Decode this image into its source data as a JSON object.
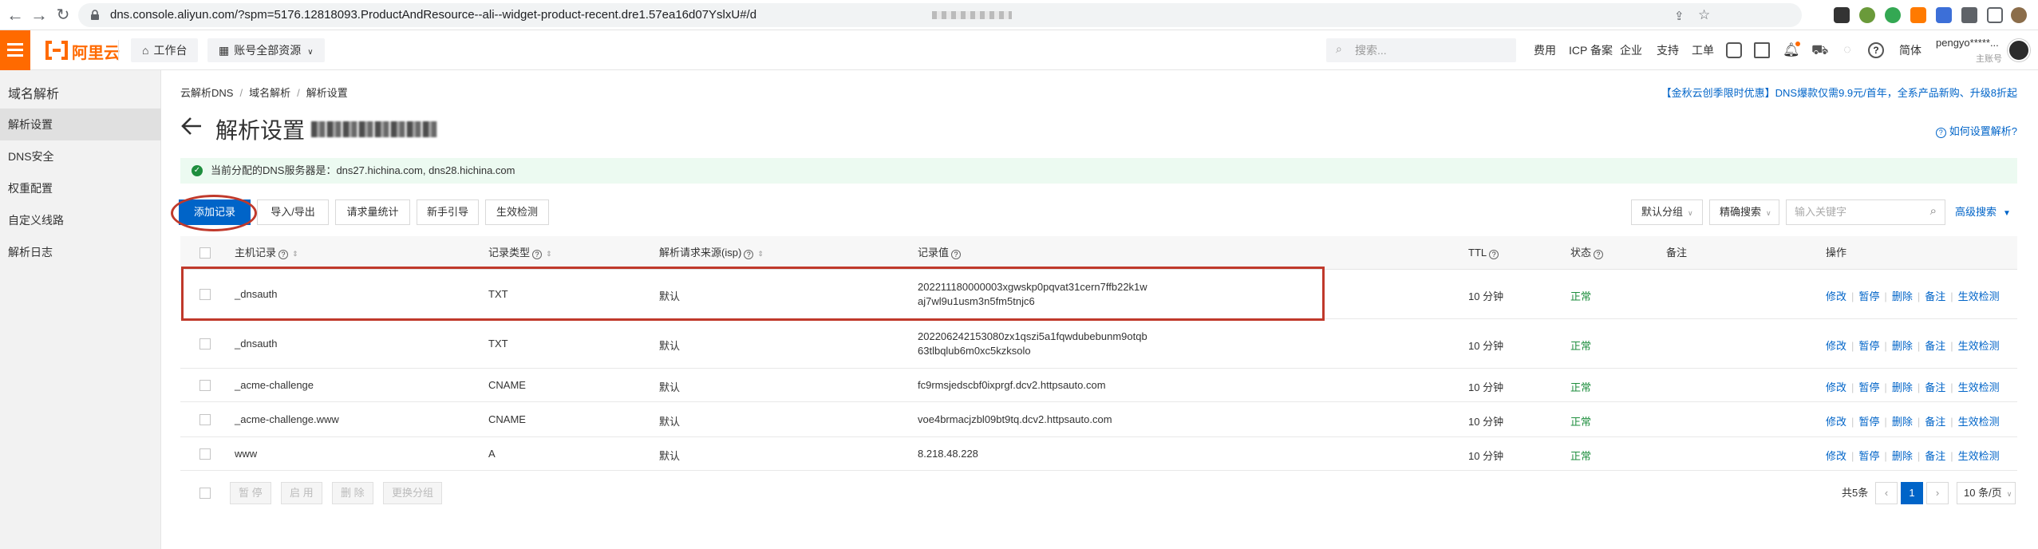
{
  "browser": {
    "url": "dns.console.aliyun.com/?spm=5176.12818093.ProductAndResource--ali--widget-product-recent.dre1.57ea16d07YslxU#/d"
  },
  "appbar": {
    "logo_text": "阿里云",
    "workbench": "工作台",
    "account_resources": "账号全部资源",
    "search_placeholder": "搜索...",
    "links": [
      "费用",
      "ICP 备案",
      "企业",
      "支持",
      "工单"
    ],
    "lang": "简体",
    "user_name": "pengyo*****...",
    "user_role": "主账号",
    "brand_color": "#ff6a00"
  },
  "sidebar": {
    "title": "域名解析",
    "items": [
      {
        "label": "解析设置",
        "active": true
      },
      {
        "label": "DNS安全",
        "active": false
      },
      {
        "label": "权重配置",
        "active": false
      },
      {
        "label": "自定义线路",
        "active": false
      },
      {
        "label": "解析日志",
        "active": false
      }
    ]
  },
  "main": {
    "breadcrumb": [
      "云解析DNS",
      "域名解析",
      "解析设置"
    ],
    "promo": "【金秋云创季限时优惠】DNS爆款仅需9.9元/首年，全系产品新购、升级8折起",
    "title": "解析设置",
    "help_link": "如何设置解析?",
    "notice": "当前分配的DNS服务器是：dns27.hichina.com, dns28.hichina.com",
    "toolbar": {
      "add_record": "添加记录",
      "import_export": "导入/导出",
      "request_stats": "请求量统计",
      "guide": "新手引导",
      "check": "生效检测",
      "group_select": "默认分组",
      "search_type": "精确搜索",
      "keyword_placeholder": "输入关键字",
      "advanced_search": "高级搜索"
    },
    "table": {
      "headers": {
        "host": "主机记录",
        "type": "记录类型",
        "isp": "解析请求来源(isp)",
        "value": "记录值",
        "ttl": "TTL",
        "status": "状态",
        "remark": "备注",
        "actions": "操作"
      },
      "rows": [
        {
          "host": "_dnsauth",
          "type": "TXT",
          "isp": "默认",
          "value1": "202211180000003xgwskp0pqvat31cern7ffb22k1w",
          "value2": "aj7wl9u1usm3n5fm5tnjc6",
          "ttl": "10 分钟",
          "status": "正常"
        },
        {
          "host": "_dnsauth",
          "type": "TXT",
          "isp": "默认",
          "value1": "202206242153080zx1qszi5a1fqwdubebunm9otqb",
          "value2": "63tlbqlub6m0xc5kzksolo",
          "ttl": "10 分钟",
          "status": "正常"
        },
        {
          "host": "_acme-challenge",
          "type": "CNAME",
          "isp": "默认",
          "value1": "fc9rmsjedscbf0ixprgf.dcv2.httpsauto.com",
          "value2": "",
          "ttl": "10 分钟",
          "status": "正常"
        },
        {
          "host": "_acme-challenge.www",
          "type": "CNAME",
          "isp": "默认",
          "value1": "voe4brmacjzbl09bt9tq.dcv2.httpsauto.com",
          "value2": "",
          "ttl": "10 分钟",
          "status": "正常"
        },
        {
          "host": "www",
          "type": "A",
          "isp": "默认",
          "value1": "8.218.48.228",
          "value2": "",
          "ttl": "10 分钟",
          "status": "正常"
        }
      ],
      "row_actions": [
        "修改",
        "暂停",
        "删除",
        "备注",
        "生效检测"
      ]
    },
    "footer": {
      "buttons": [
        "暂 停",
        "启 用",
        "删 除",
        "更换分组"
      ],
      "total": "共5条",
      "current_page": "1",
      "page_size": "10 条/页"
    }
  }
}
